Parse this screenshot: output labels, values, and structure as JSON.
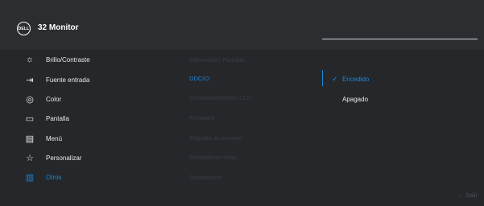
{
  "header": {
    "logo_text": "DELL",
    "title": "32 Monitor"
  },
  "menu": {
    "items": [
      {
        "label": "Brillo/Contraste",
        "icon": "brightness-icon"
      },
      {
        "label": "Fuente entrada",
        "icon": "input-source-icon"
      },
      {
        "label": "Color",
        "icon": "color-palette-icon"
      },
      {
        "label": "Pantalla",
        "icon": "display-icon"
      },
      {
        "label": "Menú",
        "icon": "menu-icon"
      },
      {
        "label": "Personalizar",
        "icon": "star-icon"
      },
      {
        "label": "Otros",
        "icon": "others-icon"
      }
    ]
  },
  "submenu": {
    "items": [
      "Información Pantalla",
      "DDC/CI",
      "Condicionamiento LCD",
      "Firmware",
      "Etiqueta de servicio",
      "Restablecer otros",
      "Restablecer"
    ]
  },
  "options": {
    "on": "Encedido",
    "off": "Apagado",
    "selected_check": "✓"
  },
  "footer": {
    "exit_label": "Salir",
    "exit_icon": "chevron-left-icon"
  },
  "colors": {
    "accent": "#1e86d8",
    "background": "#25272b",
    "header": "#2b2d31"
  }
}
